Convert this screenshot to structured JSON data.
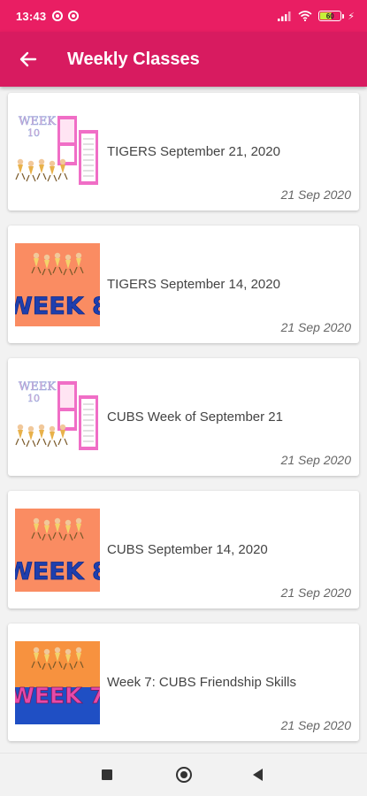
{
  "status_bar": {
    "time": "13:43",
    "battery_level": 60,
    "battery_text": "60",
    "icons": [
      "whatsapp-icon",
      "whatsapp-icon",
      "signal-icon",
      "wifi-icon",
      "battery-icon",
      "charging-icon"
    ]
  },
  "app_bar": {
    "back_icon": "arrow-left-icon",
    "title": "Weekly Classes"
  },
  "classes": [
    {
      "title": "TIGERS September 21, 2020",
      "date": "21 Sep 2020",
      "thumbnail": "week-10-collage"
    },
    {
      "title": "TIGERS September 14, 2020",
      "date": "21 Sep 2020",
      "thumbnail": "week-8-orange"
    },
    {
      "title": "CUBS Week of September 21",
      "date": "21 Sep 2020",
      "thumbnail": "week-10-collage"
    },
    {
      "title": "CUBS September 14, 2020",
      "date": "21 Sep 2020",
      "thumbnail": "week-8-orange"
    },
    {
      "title": "Week 7: CUBS Friendship Skills",
      "date": "21 Sep 2020",
      "thumbnail": "week-7-orange-blue"
    }
  ],
  "colors": {
    "status_bar": "#e91e63",
    "app_bar": "#d81b60",
    "background": "#f2f2f2",
    "card": "#ffffff"
  },
  "nav_bar": {
    "icons": [
      "recent-apps-icon",
      "home-icon",
      "back-icon"
    ]
  }
}
